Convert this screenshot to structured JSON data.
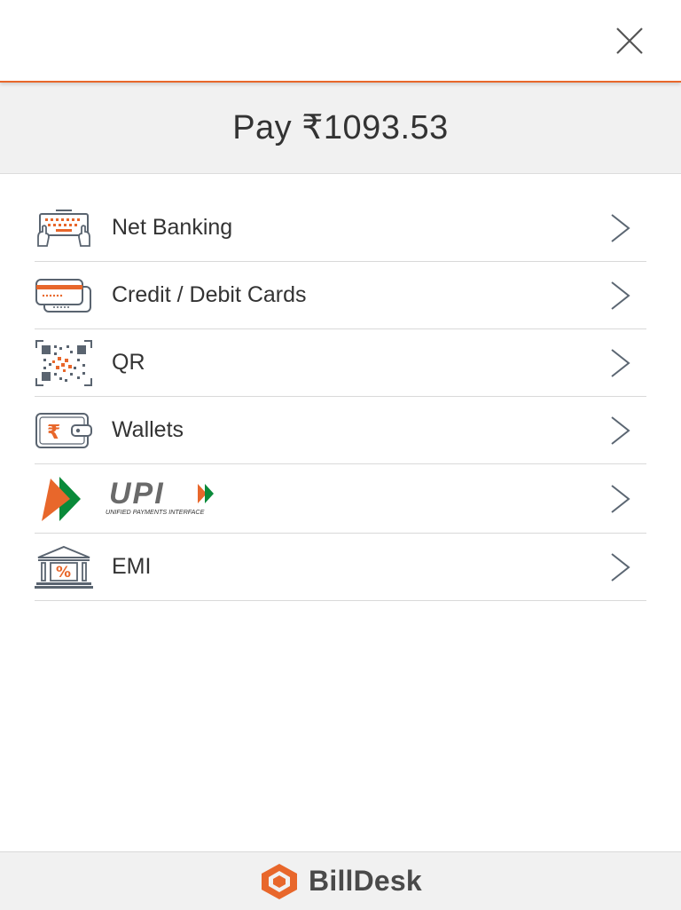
{
  "header": {
    "close_icon": "close-icon"
  },
  "amount": {
    "label": "Pay ₹1093.53"
  },
  "methods": [
    {
      "id": "net-banking",
      "label": "Net Banking",
      "icon": "net-banking-icon"
    },
    {
      "id": "cards",
      "label": "Credit / Debit Cards",
      "icon": "cards-icon"
    },
    {
      "id": "qr",
      "label": "QR",
      "icon": "qr-code-icon"
    },
    {
      "id": "wallets",
      "label": "Wallets",
      "icon": "wallet-icon"
    },
    {
      "id": "upi",
      "label": "",
      "icon": "upi-logo",
      "logo_text": "UPI",
      "logo_subtext": "UNIFIED PAYMENTS INTERFACE"
    },
    {
      "id": "emi",
      "label": "EMI",
      "icon": "emi-bank-icon"
    }
  ],
  "wallet_symbol": "₹",
  "emi_symbol": "%",
  "footer": {
    "brand": "BillDesk"
  },
  "colors": {
    "accent": "#e8672b",
    "icon_outline": "#5a6470",
    "upi_green": "#0a8a3a",
    "text": "#333333",
    "panel_bg": "#f1f1f1"
  }
}
